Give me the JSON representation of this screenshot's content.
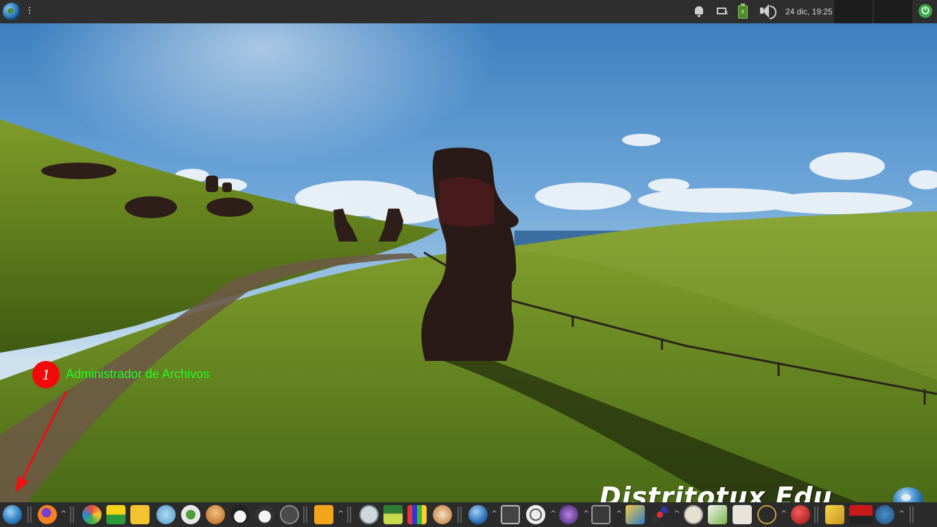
{
  "top_panel": {
    "clock": "24 dic, 19:25"
  },
  "desktop": {
    "watermark": "Distritotux Edu"
  },
  "annotation": {
    "number": "1",
    "label": "Administrador de Archivos"
  },
  "dock": {
    "apps": [
      "file-manager-icon",
      "firefox-icon",
      "kde-icon",
      "gcompris-icon",
      "sign-language-icon",
      "atlas-icon",
      "ktouch-icon",
      "tuxpaint-icon",
      "tux-icon",
      "tuxtype-icon",
      "klettres-icon",
      "scratch-icon",
      "atril-icon",
      "educational-icon",
      "puzzle-icon",
      "horse-icon",
      "globe-icon",
      "music-icon",
      "circle-tool-icon",
      "planetarium-icon",
      "math-icon",
      "photo-icon",
      "molecule-icon",
      "calculus-icon",
      "geometry-icon",
      "drawing-icon",
      "protractor-icon",
      "red-app-icon",
      "notes-icon",
      "gtick-icon",
      "mu-icon"
    ],
    "colors": {
      "panel": "#2b2b2b",
      "annotation_red": "#f20a0a",
      "annotation_green": "#1eff1e"
    }
  }
}
